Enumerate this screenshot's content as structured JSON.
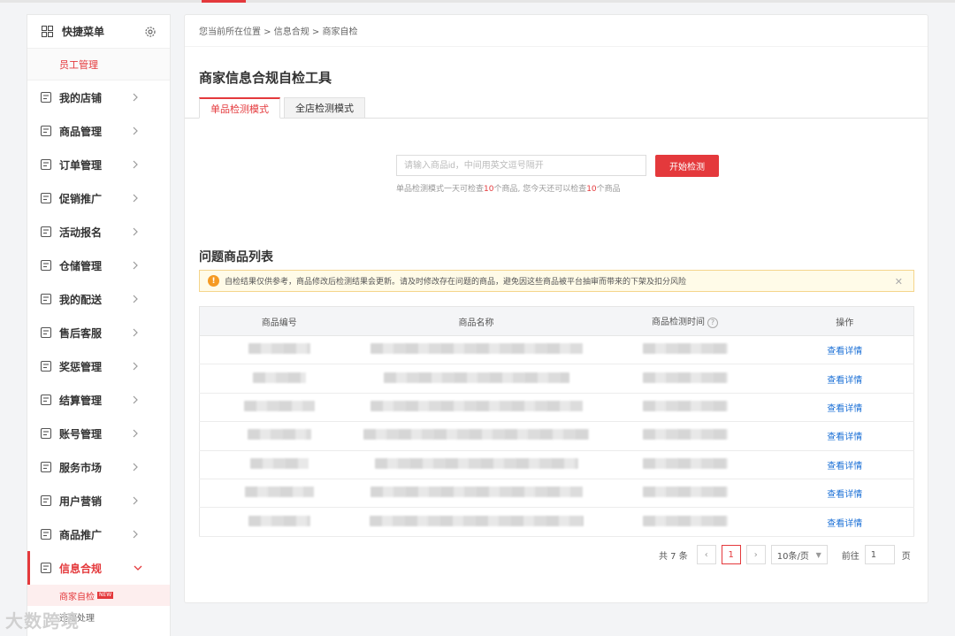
{
  "sidebar": {
    "quick_menu_title": "快捷菜单",
    "quick_menu_item": "员工管理",
    "items": [
      {
        "label": "我的店铺",
        "icon": "store-icon"
      },
      {
        "label": "商品管理",
        "icon": "goods-icon"
      },
      {
        "label": "订单管理",
        "icon": "order-icon"
      },
      {
        "label": "促销推广",
        "icon": "promotion-icon"
      },
      {
        "label": "活动报名",
        "icon": "activity-icon"
      },
      {
        "label": "仓储管理",
        "icon": "warehouse-icon"
      },
      {
        "label": "我的配送",
        "icon": "delivery-icon"
      },
      {
        "label": "售后客服",
        "icon": "service-icon"
      },
      {
        "label": "奖惩管理",
        "icon": "reward-icon"
      },
      {
        "label": "结算管理",
        "icon": "settlement-icon"
      },
      {
        "label": "账号管理",
        "icon": "account-icon"
      },
      {
        "label": "服务市场",
        "icon": "market-icon"
      },
      {
        "label": "用户营销",
        "icon": "marketing-icon"
      },
      {
        "label": "商品推广",
        "icon": "goods-promo-icon"
      },
      {
        "label": "信息合规",
        "icon": "compliance-icon"
      }
    ],
    "sub_items": [
      "商家自检",
      "违规处理"
    ],
    "new_badge": "NEW"
  },
  "breadcrumb": "您当前所在位置 > 信息合规 > 商家自检",
  "page_title": "商家信息合规自检工具",
  "tabs": [
    "单品检测模式",
    "全店检测模式"
  ],
  "search": {
    "placeholder": "请输入商品id，中间用英文逗号隔开",
    "button": "开始检测",
    "hint_prefix": "单品检测模式一天可检查",
    "hint_num1": "10",
    "hint_mid": "个商品, 您今天还可以检查",
    "hint_num2": "10",
    "hint_suffix": "个商品"
  },
  "list_title": "问题商品列表",
  "alert": "自检结果仅供参考，商品修改后检测结果会更新。请及时修改存在问题的商品，避免因这些商品被平台抽审而带来的下架及扣分风险",
  "table": {
    "headers": [
      "商品编号",
      "商品名称",
      "商品检测时间",
      "操作"
    ],
    "action_label": "查看详情",
    "row_count": 7
  },
  "pager": {
    "total": "共 7 条",
    "current_page": "1",
    "page_size": "10条/页",
    "goto_label": "前往",
    "goto_value": "1",
    "page_unit": "页"
  },
  "watermark": "大数跨境",
  "colors": {
    "accent": "#e4393c",
    "link": "#1a6fd6",
    "warning": "#f59a23"
  }
}
